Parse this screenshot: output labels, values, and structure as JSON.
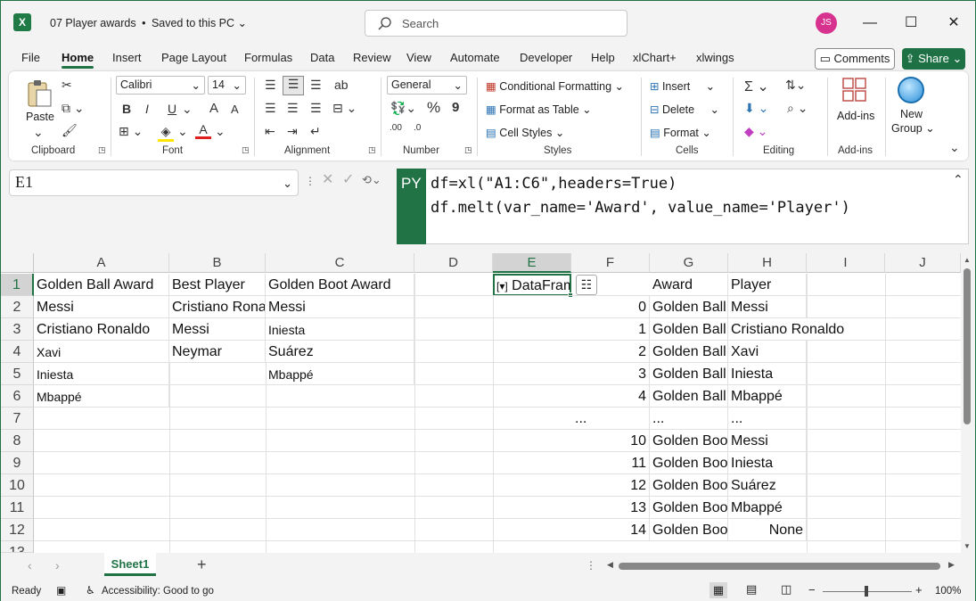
{
  "title": {
    "app_logo": "X",
    "doc": "07 Player awards",
    "sep": "•",
    "saved": "Saved to this PC",
    "chevron": "⌄"
  },
  "search": {
    "placeholder": "Search"
  },
  "user": {
    "initials": "JS"
  },
  "menu": {
    "file": "File",
    "home": "Home",
    "insert": "Insert",
    "page_layout": "Page Layout",
    "formulas": "Formulas",
    "data": "Data",
    "review": "Review",
    "view": "View",
    "automate": "Automate",
    "developer": "Developer",
    "help": "Help",
    "xlchart": "xlChart+",
    "xlwings": "xlwings"
  },
  "buttons": {
    "comments": "Comments",
    "share": "Share"
  },
  "ribbon": {
    "clipboard": {
      "paste": "Paste",
      "label": "Clipboard"
    },
    "font": {
      "family": "Calibri",
      "size": "14",
      "bold": "B",
      "italic": "I",
      "underline": "U",
      "grow": "A",
      "shrink": "A",
      "label": "Font"
    },
    "alignment": {
      "label": "Alignment"
    },
    "number": {
      "format": "General",
      "percent": "%",
      "comma": "9",
      "dec_inc": ".00",
      "label": "Number"
    },
    "styles": {
      "conditional": "Conditional Formatting",
      "table": "Format as Table",
      "cell_styles": "Cell Styles",
      "label": "Styles"
    },
    "cells": {
      "insert": "Insert",
      "delete": "Delete",
      "format": "Format",
      "label": "Cells"
    },
    "editing": {
      "label": "Editing"
    },
    "addins": {
      "addins": "Add-ins",
      "label": "Add-ins"
    },
    "newgroup": {
      "line1": "New",
      "line2": "Group"
    }
  },
  "formula": {
    "namebox": "E1",
    "py": "PY",
    "line1": "df=xl(\"A1:C6\",headers=True)",
    "line2": "df.melt(var_name='Award', value_name='Player')"
  },
  "columns": [
    "A",
    "B",
    "C",
    "D",
    "E",
    "F",
    "G",
    "H",
    "I",
    "J"
  ],
  "rows": [
    "1",
    "2",
    "3",
    "4",
    "5",
    "6",
    "7",
    "8",
    "9",
    "10",
    "11",
    "12",
    "13"
  ],
  "cells": {
    "A": [
      "Golden Ball Award",
      "Messi",
      "Cristiano Ronaldo",
      "Xavi",
      "Iniesta",
      "Mbappé",
      "",
      "",
      "",
      "",
      "",
      ""
    ],
    "B": [
      "Best Player",
      "Cristiano Ronaldo",
      "Messi",
      "Neymar",
      "",
      "",
      "",
      "",
      "",
      "",
      "",
      ""
    ],
    "C": [
      "Golden Boot Award",
      "Messi",
      "Iniesta",
      "Suárez",
      "Mbappé",
      "",
      "",
      "",
      "",
      "",
      "",
      ""
    ],
    "E": [
      "DataFrame",
      "",
      "",
      "",
      "",
      "",
      "",
      "",
      "",
      "",
      "",
      ""
    ],
    "F": [
      "",
      "0",
      "1",
      "2",
      "3",
      "4",
      "...",
      "10",
      "11",
      "12",
      "13",
      "14"
    ],
    "G": [
      "Award",
      "Golden Ball Award",
      "Golden Ball Award",
      "Golden Ball Award",
      "Golden Ball Award",
      "Golden Ball Award",
      "...",
      "Golden Boot Award",
      "Golden Boot Award",
      "Golden Boot Award",
      "Golden Boot Award",
      "Golden Boot Award"
    ],
    "H": [
      "Player",
      "Messi",
      "Cristiano Ronaldo",
      "Xavi",
      "Iniesta",
      "Mbappé",
      "...",
      "Messi",
      "Iniesta",
      "Suárez",
      "Mbappé",
      "None"
    ]
  },
  "sheet": {
    "tab": "Sheet1",
    "add": "+"
  },
  "status": {
    "ready": "Ready",
    "accessibility": "Accessibility: Good to go",
    "zoom": "100%",
    "minus": "−",
    "plus": "+"
  },
  "colors": {
    "accent": "#217346",
    "avatar": "#d6328e",
    "share": "#1e7145"
  }
}
